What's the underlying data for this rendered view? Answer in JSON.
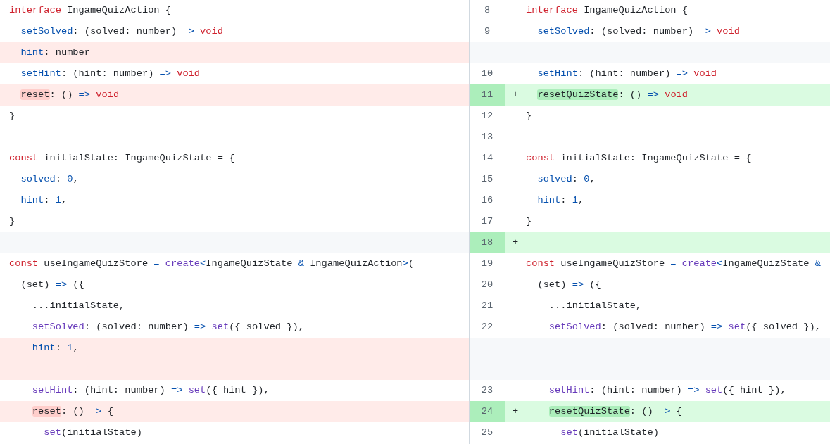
{
  "left_pane": {
    "rows": [
      {
        "kind": "context",
        "tokens": [
          {
            "kind": "keyword",
            "text": "interface"
          },
          {
            "kind": "plain",
            "text": " IngameQuizAction {"
          }
        ]
      },
      {
        "kind": "context",
        "tokens": [
          {
            "kind": "property",
            "text": "  setSolved"
          },
          {
            "kind": "plain",
            "text": ": (solved: number) "
          },
          {
            "kind": "operator",
            "text": "=>"
          },
          {
            "kind": "keyword",
            "text": " void"
          }
        ]
      },
      {
        "kind": "deleted",
        "tokens": [
          {
            "kind": "property",
            "text": "  hint"
          },
          {
            "kind": "plain",
            "text": ": number"
          }
        ]
      },
      {
        "kind": "context",
        "tokens": [
          {
            "kind": "property",
            "text": "  setHint"
          },
          {
            "kind": "plain",
            "text": ": (hint: number) "
          },
          {
            "kind": "operator",
            "text": "=>"
          },
          {
            "kind": "keyword",
            "text": " void"
          }
        ]
      },
      {
        "kind": "deleted",
        "tokens": [
          {
            "kind": "plain",
            "text": "  reset",
            "highlight": true
          },
          {
            "kind": "plain",
            "text": ": () "
          },
          {
            "kind": "operator",
            "text": "=>"
          },
          {
            "kind": "keyword",
            "text": " void"
          }
        ]
      },
      {
        "kind": "context",
        "tokens": [
          {
            "kind": "plain",
            "text": "}"
          }
        ]
      },
      {
        "kind": "context"
      },
      {
        "kind": "context",
        "tokens": [
          {
            "kind": "keyword",
            "text": "const"
          },
          {
            "kind": "plain",
            "text": " initialState: IngameQuizState = {"
          }
        ]
      },
      {
        "kind": "context",
        "tokens": [
          {
            "kind": "property",
            "text": "  solved"
          },
          {
            "kind": "plain",
            "text": ": "
          },
          {
            "kind": "number",
            "text": "0"
          },
          {
            "kind": "plain",
            "text": ","
          }
        ]
      },
      {
        "kind": "context",
        "tokens": [
          {
            "kind": "property",
            "text": "  hint"
          },
          {
            "kind": "plain",
            "text": ": "
          },
          {
            "kind": "number",
            "text": "1"
          },
          {
            "kind": "plain",
            "text": ","
          }
        ]
      },
      {
        "kind": "context",
        "tokens": [
          {
            "kind": "plain",
            "text": "}"
          }
        ]
      },
      {
        "kind": "filler"
      },
      {
        "kind": "context",
        "tokens": [
          {
            "kind": "keyword",
            "text": "const"
          },
          {
            "kind": "plain",
            "text": " useIngameQuizStore "
          },
          {
            "kind": "operator",
            "text": "="
          },
          {
            "kind": "function",
            "text": " create"
          },
          {
            "kind": "operator",
            "text": "<"
          },
          {
            "kind": "plain",
            "text": "IngameQuizState "
          },
          {
            "kind": "operator",
            "text": "&"
          },
          {
            "kind": "plain",
            "text": " IngameQuizAction"
          },
          {
            "kind": "operator",
            "text": ">"
          },
          {
            "kind": "plain",
            "text": "("
          }
        ]
      },
      {
        "kind": "context",
        "tokens": [
          {
            "kind": "plain",
            "text": "  (set) "
          },
          {
            "kind": "operator",
            "text": "=>"
          },
          {
            "kind": "plain",
            "text": " ({"
          }
        ]
      },
      {
        "kind": "context",
        "tokens": [
          {
            "kind": "plain",
            "text": "    ...initialState,"
          }
        ]
      },
      {
        "kind": "context",
        "tokens": [
          {
            "kind": "function",
            "text": "    setSolved"
          },
          {
            "kind": "plain",
            "text": ": (solved: number) "
          },
          {
            "kind": "operator",
            "text": "=>"
          },
          {
            "kind": "function",
            "text": " set"
          },
          {
            "kind": "plain",
            "text": "({ solved }),"
          }
        ]
      },
      {
        "kind": "deleted",
        "tokens": [
          {
            "kind": "property",
            "text": "    hint"
          },
          {
            "kind": "plain",
            "text": ": "
          },
          {
            "kind": "number",
            "text": "1"
          },
          {
            "kind": "plain",
            "text": ","
          }
        ]
      },
      {
        "kind": "deleted"
      },
      {
        "kind": "context",
        "tokens": [
          {
            "kind": "function",
            "text": "    setHint"
          },
          {
            "kind": "plain",
            "text": ": (hint: number) "
          },
          {
            "kind": "operator",
            "text": "=>"
          },
          {
            "kind": "function",
            "text": " set"
          },
          {
            "kind": "plain",
            "text": "({ hint }),"
          }
        ]
      },
      {
        "kind": "deleted",
        "tokens": [
          {
            "kind": "plain",
            "text": "    reset",
            "highlight": true
          },
          {
            "kind": "plain",
            "text": ": () "
          },
          {
            "kind": "operator",
            "text": "=>"
          },
          {
            "kind": "plain",
            "text": " {"
          }
        ]
      },
      {
        "kind": "context",
        "tokens": [
          {
            "kind": "function",
            "text": "      set"
          },
          {
            "kind": "plain",
            "text": "(initialState)"
          }
        ]
      }
    ]
  },
  "right_pane": {
    "rows": [
      {
        "kind": "context",
        "number": "8",
        "tokens": [
          {
            "kind": "keyword",
            "text": "interface"
          },
          {
            "kind": "plain",
            "text": " IngameQuizAction {"
          }
        ]
      },
      {
        "kind": "context",
        "number": "9",
        "tokens": [
          {
            "kind": "property",
            "text": "  setSolved"
          },
          {
            "kind": "plain",
            "text": ": (solved: number) "
          },
          {
            "kind": "operator",
            "text": "=>"
          },
          {
            "kind": "keyword",
            "text": " void"
          }
        ]
      },
      {
        "kind": "filler"
      },
      {
        "kind": "context",
        "number": "10",
        "tokens": [
          {
            "kind": "property",
            "text": "  setHint"
          },
          {
            "kind": "plain",
            "text": ": (hint: number) "
          },
          {
            "kind": "operator",
            "text": "=>"
          },
          {
            "kind": "keyword",
            "text": " void"
          }
        ]
      },
      {
        "kind": "added",
        "number": "11",
        "marker": "+",
        "tokens": [
          {
            "kind": "plain",
            "text": "  resetQuizState",
            "highlight": true
          },
          {
            "kind": "plain",
            "text": ": () "
          },
          {
            "kind": "operator",
            "text": "=>"
          },
          {
            "kind": "keyword",
            "text": " void"
          }
        ]
      },
      {
        "kind": "context",
        "number": "12",
        "tokens": [
          {
            "kind": "plain",
            "text": "}"
          }
        ]
      },
      {
        "kind": "context",
        "number": "13"
      },
      {
        "kind": "context",
        "number": "14",
        "tokens": [
          {
            "kind": "keyword",
            "text": "const"
          },
          {
            "kind": "plain",
            "text": " initialState: IngameQuizState = {"
          }
        ]
      },
      {
        "kind": "context",
        "number": "15",
        "tokens": [
          {
            "kind": "property",
            "text": "  solved"
          },
          {
            "kind": "plain",
            "text": ": "
          },
          {
            "kind": "number",
            "text": "0"
          },
          {
            "kind": "plain",
            "text": ","
          }
        ]
      },
      {
        "kind": "context",
        "number": "16",
        "tokens": [
          {
            "kind": "property",
            "text": "  hint"
          },
          {
            "kind": "plain",
            "text": ": "
          },
          {
            "kind": "number",
            "text": "1"
          },
          {
            "kind": "plain",
            "text": ","
          }
        ]
      },
      {
        "kind": "context",
        "number": "17",
        "tokens": [
          {
            "kind": "plain",
            "text": "}"
          }
        ]
      },
      {
        "kind": "added",
        "number": "18",
        "marker": "+"
      },
      {
        "kind": "context",
        "number": "19",
        "tokens": [
          {
            "kind": "keyword",
            "text": "const"
          },
          {
            "kind": "plain",
            "text": " useIngameQuizStore "
          },
          {
            "kind": "operator",
            "text": "="
          },
          {
            "kind": "function",
            "text": " create"
          },
          {
            "kind": "operator",
            "text": "<"
          },
          {
            "kind": "plain",
            "text": "IngameQuizState "
          },
          {
            "kind": "operator",
            "text": "&"
          }
        ]
      },
      {
        "kind": "context",
        "number": "20",
        "tokens": [
          {
            "kind": "plain",
            "text": "  (set) "
          },
          {
            "kind": "operator",
            "text": "=>"
          },
          {
            "kind": "plain",
            "text": " ({"
          }
        ]
      },
      {
        "kind": "context",
        "number": "21",
        "tokens": [
          {
            "kind": "plain",
            "text": "    ...initialState,"
          }
        ]
      },
      {
        "kind": "context",
        "number": "22",
        "tokens": [
          {
            "kind": "function",
            "text": "    setSolved"
          },
          {
            "kind": "plain",
            "text": ": (solved: number) "
          },
          {
            "kind": "operator",
            "text": "=>"
          },
          {
            "kind": "function",
            "text": " set"
          },
          {
            "kind": "plain",
            "text": "({ solved }),"
          }
        ]
      },
      {
        "kind": "filler"
      },
      {
        "kind": "filler"
      },
      {
        "kind": "context",
        "number": "23",
        "tokens": [
          {
            "kind": "function",
            "text": "    setHint"
          },
          {
            "kind": "plain",
            "text": ": (hint: number) "
          },
          {
            "kind": "operator",
            "text": "=>"
          },
          {
            "kind": "function",
            "text": " set"
          },
          {
            "kind": "plain",
            "text": "({ hint }),"
          }
        ]
      },
      {
        "kind": "added",
        "number": "24",
        "marker": "+",
        "tokens": [
          {
            "kind": "plain",
            "text": "    resetQuizState",
            "highlight": true
          },
          {
            "kind": "plain",
            "text": ": () "
          },
          {
            "kind": "operator",
            "text": "=>"
          },
          {
            "kind": "plain",
            "text": " {"
          }
        ]
      },
      {
        "kind": "context",
        "number": "25",
        "tokens": [
          {
            "kind": "function",
            "text": "      set"
          },
          {
            "kind": "plain",
            "text": "(initialState)"
          }
        ]
      }
    ]
  }
}
